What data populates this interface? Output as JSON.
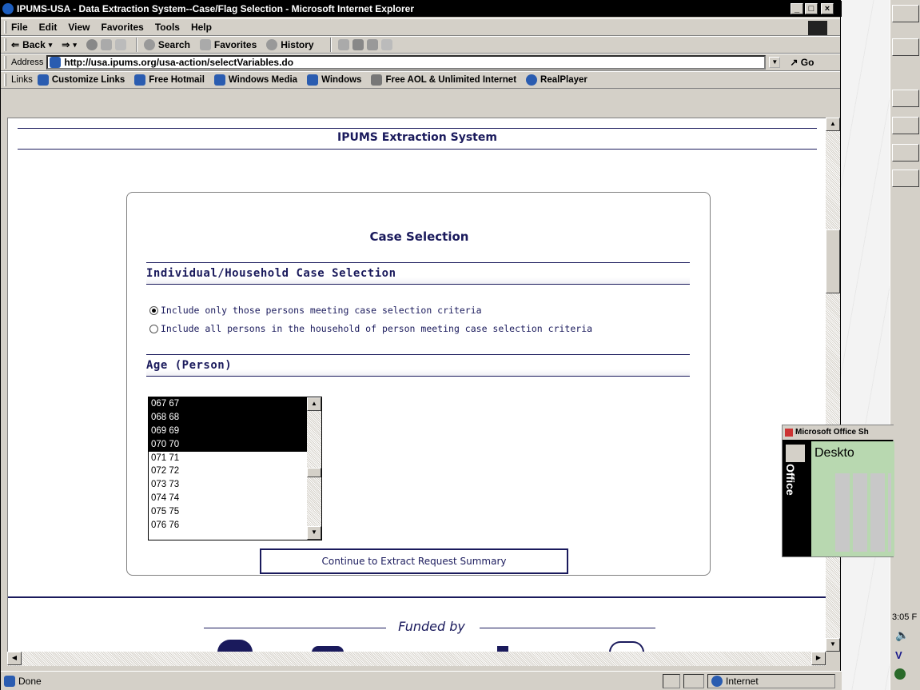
{
  "window": {
    "title": "IPUMS-USA - Data Extraction System--Case/Flag Selection - Microsoft Internet Explorer"
  },
  "menu": [
    "File",
    "Edit",
    "View",
    "Favorites",
    "Tools",
    "Help"
  ],
  "toolbar": {
    "back": "Back",
    "forward": "⇒",
    "search": "Search",
    "favorites": "Favorites",
    "history": "History"
  },
  "address": {
    "label": "Address",
    "url": "http://usa.ipums.org/usa-action/selectVariables.do",
    "go": "Go"
  },
  "links": {
    "label": "Links",
    "items": [
      "Customize Links",
      "Free Hotmail",
      "Windows Media",
      "Windows",
      "Free AOL & Unlimited Internet",
      "RealPlayer"
    ]
  },
  "page": {
    "header_title": "IPUMS Extraction System",
    "panel_title": "Case Selection",
    "section1": "Individual/Household Case Selection",
    "radio1": "Include only those persons meeting case selection criteria",
    "radio2": "Include all persons in the household of person meeting case selection criteria",
    "section2": "Age (Person)",
    "age_options": [
      {
        "label": "067 67",
        "selected": true
      },
      {
        "label": "068 68",
        "selected": true
      },
      {
        "label": "069 69",
        "selected": true
      },
      {
        "label": "070 70",
        "selected": true
      },
      {
        "label": "071 71",
        "selected": false
      },
      {
        "label": "072 72",
        "selected": false
      },
      {
        "label": "073 73",
        "selected": false
      },
      {
        "label": "074 74",
        "selected": false
      },
      {
        "label": "075 75",
        "selected": false
      },
      {
        "label": "076 76",
        "selected": false
      }
    ],
    "continue_button": "Continue to Extract Request Summary",
    "funded_by": "Funded by"
  },
  "status": {
    "text": "Done",
    "zone": "Internet"
  },
  "office_bar": {
    "title": "Microsoft Office Sh",
    "label": "Office",
    "item": "Deskto"
  },
  "clock": "3:05 F",
  "colors": {
    "brand": "#1a1a5c",
    "selection": "#000000"
  }
}
